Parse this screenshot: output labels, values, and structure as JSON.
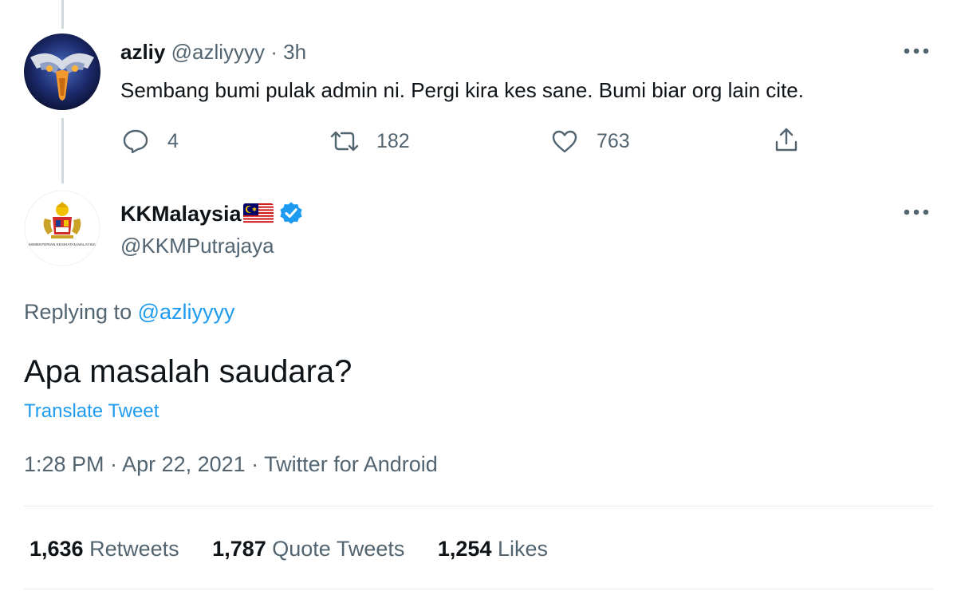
{
  "reply_tweet": {
    "author_name": "azliy",
    "author_handle": "@azliyyyy",
    "separator": "·",
    "time_ago": "3h",
    "text": "Sembang bumi pulak admin ni. Pergi kira kes sane. Bumi biar org lain cite.",
    "reply_count": "4",
    "retweet_count": "182",
    "like_count": "763",
    "avatar_icon": "eagle-avatar",
    "more_icon": "more-horizontal-icon"
  },
  "main_tweet": {
    "author_name": "KKMalaysia",
    "flag_icon": "malaysia-flag-icon",
    "verified_icon": "verified-badge-icon",
    "author_handle": "@KKMPutrajaya",
    "logo_text": "KEMENTERIAN KESIHATAN MALAYSIA",
    "replying_prefix": "Replying to",
    "replying_handle": "@azliyyyy",
    "text": "Apa masalah saudara?",
    "translate_label": "Translate Tweet",
    "timestamp": "1:28 PM · Apr 22, 2021 · Twitter for Android",
    "stats": {
      "retweets_count": "1,636",
      "retweets_label": "Retweets",
      "quote_count": "1,787",
      "quote_label": "Quote Tweets",
      "likes_count": "1,254",
      "likes_label": "Likes"
    }
  },
  "colors": {
    "link_blue": "#1d9bf0",
    "secondary_text": "#536471",
    "primary_text": "#0f1419",
    "thread_line": "#cfd9de"
  }
}
